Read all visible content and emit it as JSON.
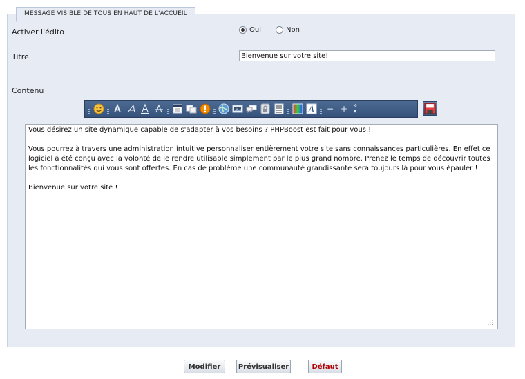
{
  "fieldset": {
    "legend": "MESSAGE VISIBLE DE TOUS EN HAUT DE L'ACCUEIL"
  },
  "edito": {
    "label": "Activer l'édito",
    "options": [
      {
        "label": "Oui",
        "checked": true
      },
      {
        "label": "Non",
        "checked": false
      }
    ]
  },
  "title": {
    "label": "Titre",
    "value": "Bienvenue sur votre site!"
  },
  "content": {
    "label": "Contenu",
    "text": "Vous désirez un site dynamique capable de s'adapter à vos besoins ? PHPBoost est fait pour vous !\n\nVous pourrez à travers une administration intuitive personnaliser entièrement votre site sans connaissances particulières. En effet ce logiciel a été conçu avec la volonté de le rendre utilisable simplement par le plus grand nombre. Prenez le temps de découvrir toutes les fonctionnalités qui vous sont offertes. En cas de problème une communauté grandissante sera toujours là pour vous épauler !\n\nBienvenue sur votre site !"
  },
  "toolbar": {
    "icons": [
      "smiley-icon",
      "bold-icon",
      "italic-icon",
      "underline-icon",
      "strikethrough-icon",
      "title-icon",
      "block-icon",
      "warning-icon",
      "link-icon",
      "image-icon",
      "quote-icon",
      "hide-icon",
      "list-icon",
      "color-icon",
      "font-icon",
      "text-size-decrease-icon",
      "text-size-increase-icon",
      "more-icon",
      "save-icon"
    ],
    "size_minus": "−",
    "size_plus": "+",
    "more": "»"
  },
  "buttons": {
    "modify": "Modifier",
    "preview": "Prévisualiser",
    "reset": "Défaut"
  },
  "colors": {
    "panel_bg": "#e6ebf4",
    "toolbar_bg": "#3f5d87",
    "reset_text": "#b00000"
  }
}
